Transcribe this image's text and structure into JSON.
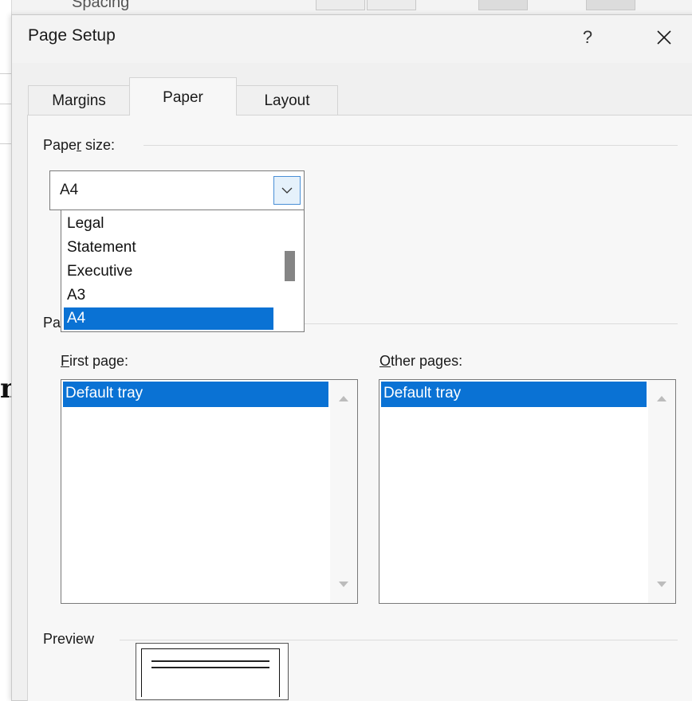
{
  "background": {
    "ribbon_partial_text": "Spacing",
    "doc_partial_glyph": "n"
  },
  "dialog": {
    "title": "Page Setup",
    "help_label": "?",
    "close_label": "✕"
  },
  "tabs": [
    {
      "label": "Margins",
      "active": false
    },
    {
      "label": "Paper",
      "active": true
    },
    {
      "label": "Layout",
      "active": false
    }
  ],
  "paper_size": {
    "label_before": "Pape",
    "label_mnemonic": "r",
    "label_after": " size:",
    "value": "A4",
    "options": [
      "Legal",
      "Statement",
      "Executive",
      "A3",
      "A4"
    ],
    "selected": "A4"
  },
  "paper_source": {
    "label_partial": "Pa",
    "first_page": {
      "label_mnemonic": "F",
      "label_rest": "irst page:",
      "items": [
        "Default tray"
      ]
    },
    "other_pages": {
      "label_mnemonic": "O",
      "label_rest": "ther pages:",
      "items": [
        "Default tray"
      ]
    }
  },
  "preview": {
    "label": "Preview"
  },
  "colors": {
    "selection": "#0a72d4",
    "dialog_bg": "#f0f0f0",
    "combo_button_border": "#4a8fd6"
  }
}
